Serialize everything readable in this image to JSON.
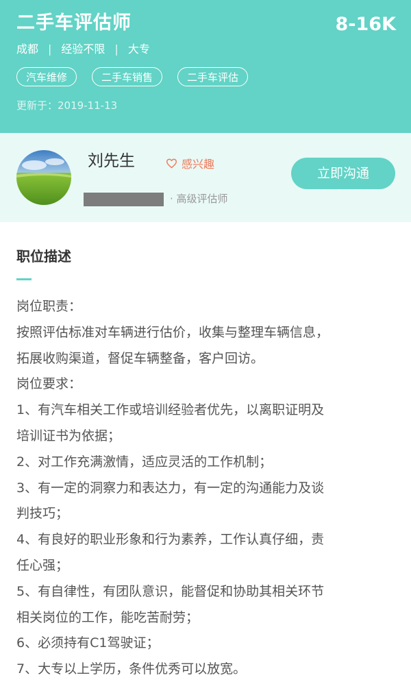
{
  "job": {
    "title": "二手车评估师",
    "salary": "8-16K",
    "city": "成都",
    "experience": "经验不限",
    "education": "大专",
    "tags": [
      "汽车维修",
      "二手车销售",
      "二手车评估"
    ],
    "updated": "更新于：2019-11-13"
  },
  "recruiter": {
    "name": "刘先生",
    "interest_label": "感兴趣",
    "role": "· 高级评估师",
    "chat_button": "立即沟通"
  },
  "description": {
    "title": "职位描述",
    "lines": [
      "岗位职责：",
      "按照评估标准对车辆进行估价，收集与整理车辆信息，",
      "拓展收购渠道，督促车辆整备，客户回访。",
      "岗位要求：",
      "1、有汽车相关工作或培训经验者优先，以离职证明及",
      "培训证书为依据；",
      "2、对工作充满激情，适应灵活的工作机制；",
      "3、有一定的洞察力和表达力，有一定的沟通能力及谈",
      "判技巧；",
      "4、有良好的职业形象和行为素养，工作认真仔细，责",
      "任心强；",
      "5、有自律性，有团队意识，能督促和协助其相关环节",
      "相关岗位的工作，能吃苦耐劳；",
      "6、必须持有C1驾驶证；",
      "7、大专以上学历，条件优秀可以放宽。"
    ]
  },
  "colors": {
    "accent": "#62d3c6",
    "light_bg": "#e9f9f6",
    "interest": "#f07a5a"
  },
  "icons": {
    "interest": "heart-outline-icon",
    "avatar": "landscape-photo"
  }
}
